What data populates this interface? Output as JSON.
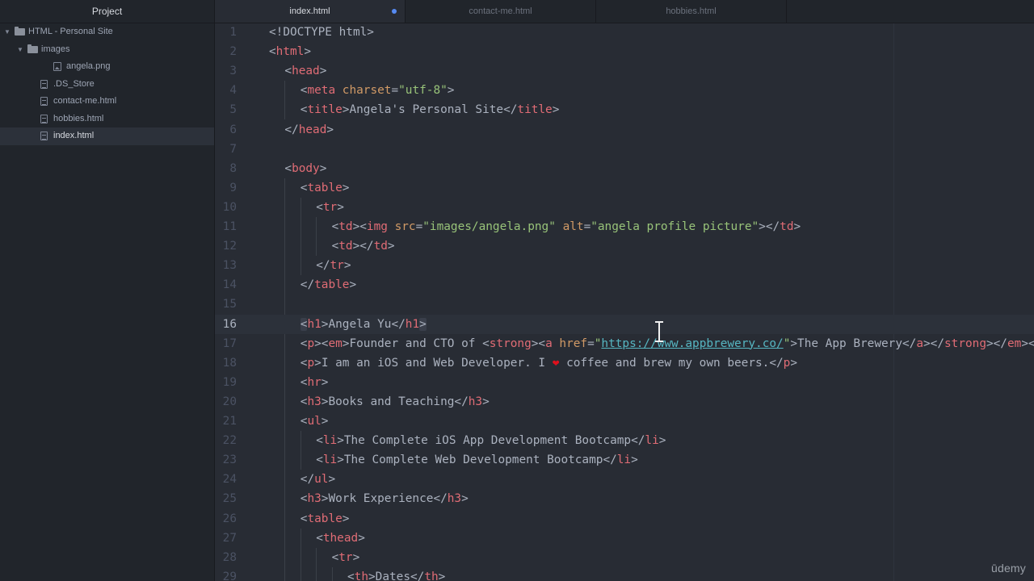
{
  "sidebar": {
    "title": "Project",
    "tree": [
      {
        "label": "HTML - Personal Site",
        "kind": "folder",
        "expanded": true,
        "depth": 0
      },
      {
        "label": "images",
        "kind": "folder",
        "expanded": true,
        "depth": 1
      },
      {
        "label": "angela.png",
        "kind": "image",
        "depth": 2
      },
      {
        "label": ".DS_Store",
        "kind": "file",
        "depth": 1
      },
      {
        "label": "contact-me.html",
        "kind": "file",
        "depth": 1
      },
      {
        "label": "hobbies.html",
        "kind": "file",
        "depth": 1
      },
      {
        "label": "index.html",
        "kind": "file",
        "depth": 1,
        "selected": true
      }
    ]
  },
  "tabs": [
    {
      "label": "index.html",
      "active": true,
      "modified": true
    },
    {
      "label": "contact-me.html",
      "active": false,
      "modified": false
    },
    {
      "label": "hobbies.html",
      "active": false,
      "modified": false
    }
  ],
  "editor": {
    "current_line": 16,
    "lines": [
      {
        "n": "1",
        "indent": 0,
        "tokens": [
          [
            "p",
            "<!DOCTYPE html>"
          ]
        ]
      },
      {
        "n": "2",
        "indent": 0,
        "tokens": [
          [
            "p",
            "<"
          ],
          [
            "t",
            "html"
          ],
          [
            "p",
            ">"
          ]
        ]
      },
      {
        "n": "3",
        "indent": 1,
        "tokens": [
          [
            "p",
            "<"
          ],
          [
            "t",
            "head"
          ],
          [
            "p",
            ">"
          ]
        ]
      },
      {
        "n": "4",
        "indent": 2,
        "tokens": [
          [
            "p",
            "<"
          ],
          [
            "t",
            "meta"
          ],
          [
            "p",
            " "
          ],
          [
            "a",
            "charset"
          ],
          [
            "p",
            "="
          ],
          [
            "s",
            "\"utf-8\""
          ],
          [
            "p",
            ">"
          ]
        ]
      },
      {
        "n": "5",
        "indent": 2,
        "tokens": [
          [
            "p",
            "<"
          ],
          [
            "t",
            "title"
          ],
          [
            "p",
            ">"
          ],
          [
            "x",
            "Angela's Personal Site"
          ],
          [
            "p",
            "</"
          ],
          [
            "t",
            "title"
          ],
          [
            "p",
            ">"
          ]
        ]
      },
      {
        "n": "6",
        "indent": 1,
        "tokens": [
          [
            "p",
            "</"
          ],
          [
            "t",
            "head"
          ],
          [
            "p",
            ">"
          ]
        ]
      },
      {
        "n": "7",
        "indent": 0,
        "tokens": []
      },
      {
        "n": "8",
        "indent": 1,
        "tokens": [
          [
            "p",
            "<"
          ],
          [
            "t",
            "body"
          ],
          [
            "p",
            ">"
          ]
        ]
      },
      {
        "n": "9",
        "indent": 2,
        "tokens": [
          [
            "p",
            "<"
          ],
          [
            "t",
            "table"
          ],
          [
            "p",
            ">"
          ]
        ]
      },
      {
        "n": "10",
        "indent": 3,
        "tokens": [
          [
            "p",
            "<"
          ],
          [
            "t",
            "tr"
          ],
          [
            "p",
            ">"
          ]
        ]
      },
      {
        "n": "11",
        "indent": 4,
        "tokens": [
          [
            "p",
            "<"
          ],
          [
            "t",
            "td"
          ],
          [
            "p",
            "><"
          ],
          [
            "t",
            "img"
          ],
          [
            "p",
            " "
          ],
          [
            "a",
            "src"
          ],
          [
            "p",
            "="
          ],
          [
            "s",
            "\"images/angela.png\""
          ],
          [
            "p",
            " "
          ],
          [
            "a",
            "alt"
          ],
          [
            "p",
            "="
          ],
          [
            "s",
            "\"angela profile picture\""
          ],
          [
            "p",
            "></"
          ],
          [
            "t",
            "td"
          ],
          [
            "p",
            ">"
          ]
        ]
      },
      {
        "n": "12",
        "indent": 4,
        "tokens": [
          [
            "p",
            "<"
          ],
          [
            "t",
            "td"
          ],
          [
            "p",
            "></"
          ],
          [
            "t",
            "td"
          ],
          [
            "p",
            ">"
          ]
        ]
      },
      {
        "n": "13",
        "indent": 3,
        "tokens": [
          [
            "p",
            "</"
          ],
          [
            "t",
            "tr"
          ],
          [
            "p",
            ">"
          ]
        ]
      },
      {
        "n": "14",
        "indent": 2,
        "tokens": [
          [
            "p",
            "</"
          ],
          [
            "t",
            "table"
          ],
          [
            "p",
            ">"
          ]
        ]
      },
      {
        "n": "15",
        "indent": 0,
        "tokens": []
      },
      {
        "n": "16",
        "indent": 2,
        "tokens": [
          [
            "hb",
            "<"
          ],
          [
            "t",
            "h1"
          ],
          [
            "p",
            ">"
          ],
          [
            "x",
            "Angela Yu"
          ],
          [
            "p",
            "</"
          ],
          [
            "t",
            "h1"
          ],
          [
            "hb",
            ">"
          ]
        ]
      },
      {
        "n": "17",
        "indent": 2,
        "tokens": [
          [
            "p",
            "<"
          ],
          [
            "t",
            "p"
          ],
          [
            "p",
            "><"
          ],
          [
            "t",
            "em"
          ],
          [
            "p",
            ">"
          ],
          [
            "x",
            "Founder and CTO of "
          ],
          [
            "p",
            "<"
          ],
          [
            "t",
            "strong"
          ],
          [
            "p",
            "><"
          ],
          [
            "t",
            "a"
          ],
          [
            "p",
            " "
          ],
          [
            "a",
            "href"
          ],
          [
            "p",
            "="
          ],
          [
            "s",
            "\""
          ],
          [
            "l",
            "https://www.appbrewery.co/"
          ],
          [
            "s",
            "\""
          ],
          [
            "p",
            ">"
          ],
          [
            "x",
            "The App Brewery"
          ],
          [
            "p",
            "</"
          ],
          [
            "t",
            "a"
          ],
          [
            "p",
            "></"
          ],
          [
            "t",
            "strong"
          ],
          [
            "p",
            "></"
          ],
          [
            "t",
            "em"
          ],
          [
            "p",
            "></"
          ],
          [
            "t",
            "p"
          ],
          [
            "p",
            ">"
          ]
        ]
      },
      {
        "n": "18",
        "indent": 2,
        "tokens": [
          [
            "p",
            "<"
          ],
          [
            "t",
            "p"
          ],
          [
            "p",
            ">"
          ],
          [
            "x",
            "I am an iOS and Web Developer. I "
          ],
          [
            "h",
            "❤"
          ],
          [
            "x",
            " coffee and brew my own beers."
          ],
          [
            "p",
            "</"
          ],
          [
            "t",
            "p"
          ],
          [
            "p",
            ">"
          ]
        ]
      },
      {
        "n": "19",
        "indent": 2,
        "tokens": [
          [
            "p",
            "<"
          ],
          [
            "t",
            "hr"
          ],
          [
            "p",
            ">"
          ]
        ]
      },
      {
        "n": "20",
        "indent": 2,
        "tokens": [
          [
            "p",
            "<"
          ],
          [
            "t",
            "h3"
          ],
          [
            "p",
            ">"
          ],
          [
            "x",
            "Books and Teaching"
          ],
          [
            "p",
            "</"
          ],
          [
            "t",
            "h3"
          ],
          [
            "p",
            ">"
          ]
        ]
      },
      {
        "n": "21",
        "indent": 2,
        "tokens": [
          [
            "p",
            "<"
          ],
          [
            "t",
            "ul"
          ],
          [
            "p",
            ">"
          ]
        ]
      },
      {
        "n": "22",
        "indent": 3,
        "tokens": [
          [
            "p",
            "<"
          ],
          [
            "t",
            "li"
          ],
          [
            "p",
            ">"
          ],
          [
            "x",
            "The Complete iOS App Development Bootcamp"
          ],
          [
            "p",
            "</"
          ],
          [
            "t",
            "li"
          ],
          [
            "p",
            ">"
          ]
        ]
      },
      {
        "n": "23",
        "indent": 3,
        "tokens": [
          [
            "p",
            "<"
          ],
          [
            "t",
            "li"
          ],
          [
            "p",
            ">"
          ],
          [
            "x",
            "The Complete Web Development Bootcamp"
          ],
          [
            "p",
            "</"
          ],
          [
            "t",
            "li"
          ],
          [
            "p",
            ">"
          ]
        ]
      },
      {
        "n": "24",
        "indent": 2,
        "tokens": [
          [
            "p",
            "</"
          ],
          [
            "t",
            "ul"
          ],
          [
            "p",
            ">"
          ]
        ]
      },
      {
        "n": "25",
        "indent": 2,
        "tokens": [
          [
            "p",
            "<"
          ],
          [
            "t",
            "h3"
          ],
          [
            "p",
            ">"
          ],
          [
            "x",
            "Work Experience"
          ],
          [
            "p",
            "</"
          ],
          [
            "t",
            "h3"
          ],
          [
            "p",
            ">"
          ]
        ]
      },
      {
        "n": "26",
        "indent": 2,
        "tokens": [
          [
            "p",
            "<"
          ],
          [
            "t",
            "table"
          ],
          [
            "p",
            ">"
          ]
        ]
      },
      {
        "n": "27",
        "indent": 3,
        "tokens": [
          [
            "p",
            "<"
          ],
          [
            "t",
            "thead"
          ],
          [
            "p",
            ">"
          ]
        ]
      },
      {
        "n": "28",
        "indent": 4,
        "tokens": [
          [
            "p",
            "<"
          ],
          [
            "t",
            "tr"
          ],
          [
            "p",
            ">"
          ]
        ]
      },
      {
        "n": "29",
        "indent": 5,
        "tokens": [
          [
            "p",
            "<"
          ],
          [
            "t",
            "th"
          ],
          [
            "p",
            ">"
          ],
          [
            "x",
            "Dates"
          ],
          [
            "p",
            "</"
          ],
          [
            "t",
            "th"
          ],
          [
            "p",
            ">"
          ]
        ]
      }
    ]
  },
  "watermark": "ūdemy",
  "colors": {
    "sidebar_bg": "#21252b",
    "editor_bg": "#282c34",
    "tag": "#e06c75",
    "attribute": "#d19a66",
    "string": "#98c379",
    "link": "#56b6c2",
    "text": "#abb2bf",
    "modified_dot": "#568af2"
  },
  "icons": {
    "folder": "folder-icon",
    "file": "file-icon",
    "image": "image-file-icon",
    "cursor": "text-cursor-icon"
  }
}
